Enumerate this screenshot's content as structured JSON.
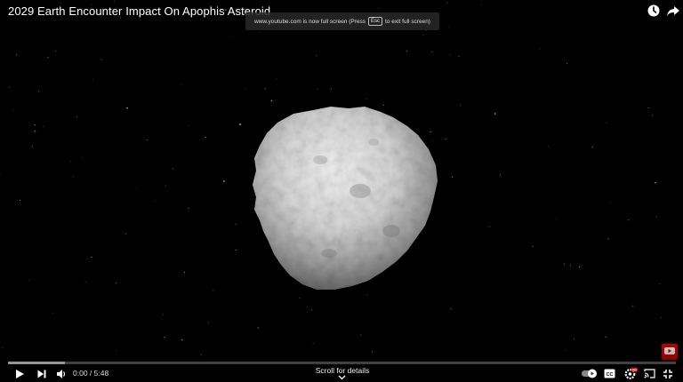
{
  "video": {
    "title": "2029 Earth Encounter Impact On Apophis Asteroid",
    "watermark_icon": "youtube-logo-icon"
  },
  "top_controls": {
    "watch_later_icon": "clock-icon",
    "share_icon": "share-arrow-icon"
  },
  "fullscreen_notice": {
    "text_before": "www.youtube.com is now full screen (Press",
    "key": "Esc",
    "text_after": "to exit full screen)"
  },
  "player": {
    "current_time": "0:00",
    "separator": " / ",
    "duration": "5:48",
    "progress_fraction": 0.0,
    "buffered_fraction": 0.085,
    "scroll_label": "Scroll for details",
    "autoplay_on": true
  },
  "controls": {
    "play_icon": "play-icon",
    "next_icon": "next-track-icon",
    "volume_icon": "volume-icon",
    "autoplay_icon": "autoplay-toggle-icon",
    "captions_icon": "captions-icon",
    "settings_icon": "settings-gear-icon",
    "cast_icon": "cast-icon",
    "exit_fullscreen_icon": "exit-fullscreen-icon"
  },
  "colors": {
    "progress_red": "#ff0000",
    "background": "#000000",
    "hd_badge": "#cc0000"
  }
}
